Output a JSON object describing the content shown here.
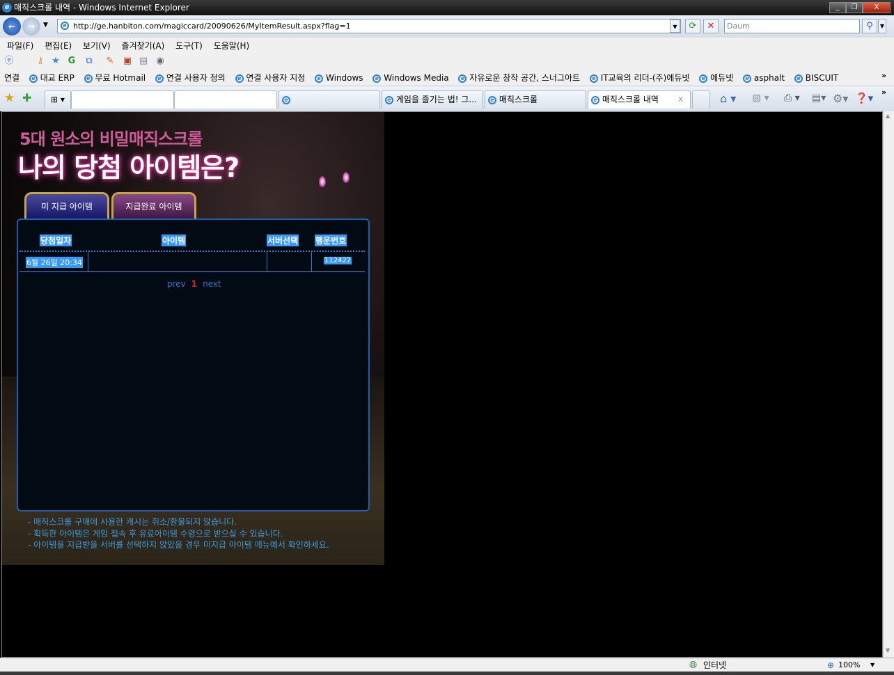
{
  "window": {
    "title": "매직스크롤 내역 - Windows Internet Explorer",
    "minimize": "_",
    "restore": "❐",
    "close": "X"
  },
  "nav": {
    "url": "http://ge.hanbiton.com/magiccard/20090626/MyItemResult.aspx?flag=1",
    "search_placeholder": "Daum"
  },
  "menu": [
    "파일(F)",
    "편집(E)",
    "보기(V)",
    "즐겨찾기(A)",
    "도구(T)",
    "도움말(H)"
  ],
  "links": {
    "label": "연결",
    "items": [
      "대교 ERP",
      "무료 Hotmail",
      "연결 사용자 정의",
      "연결 사용자 지정",
      "Windows",
      "Windows Media",
      "자유로운 창작 공간, 스너그아트",
      "IT교육의 리더-(주)에듀넷",
      "에듀넷",
      "asphalt",
      "BISCUIT"
    ],
    "more": "»"
  },
  "tabs": [
    {
      "label": ""
    },
    {
      "label": ""
    },
    {
      "label": ""
    },
    {
      "label": "게임을 즐기는 법! 그..."
    },
    {
      "label": "매직스크롤"
    },
    {
      "label": "매직스크롤 내역",
      "active": true
    }
  ],
  "tab_close": "x",
  "page": {
    "subtitle": "5대 원소의 비밀매직스크롤",
    "headline": "나의 당첨 아이템은?",
    "tab_unpaid": "미 지급 아이템",
    "tab_paid": "지급완료 아이템",
    "table": {
      "headers": [
        "당첨일자",
        "아이템",
        "서버선택",
        "행운번호"
      ],
      "rows": [
        [
          "6월 26일 20:34",
          "",
          "",
          "112422"
        ]
      ]
    },
    "pager": {
      "prev": "prev",
      "current": "1",
      "next": "next"
    },
    "notes": [
      "- 매직스크롤 구매에 사용한 캐시는 취소/환불되지 않습니다.",
      "- 획득한 아이템은 게임 접속 후 유료아이템 수령으로 받으실 수 있습니다.",
      "- 아이템을 지급받을 서버를 선택하지 않았을 경우 미지급 아이템 메뉴에서 확인하세요."
    ]
  },
  "status": {
    "zone": "인터넷",
    "zoom": "100%"
  }
}
